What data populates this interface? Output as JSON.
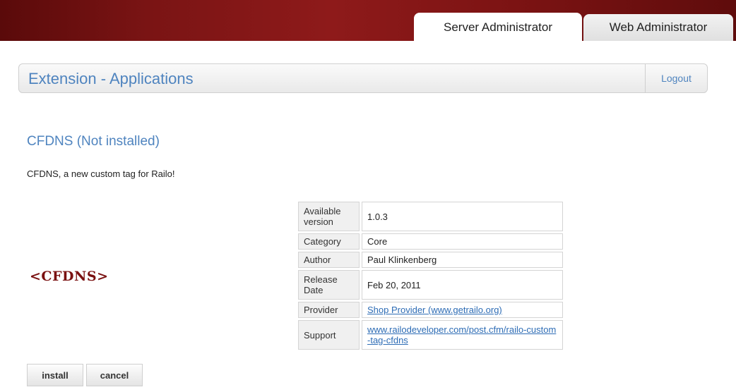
{
  "header": {
    "tabs": [
      {
        "label": "Server Administrator",
        "active": true
      },
      {
        "label": "Web Administrator",
        "active": false
      }
    ]
  },
  "page_bar": {
    "title": "Extension - Applications",
    "logout_label": "Logout"
  },
  "extension": {
    "title": "CFDNS (Not installed)",
    "description": "CFDNS, a new custom tag for Railo!",
    "logo_text": "<CFDNS>",
    "details": [
      {
        "label": "Available version",
        "value": "1.0.3"
      },
      {
        "label": "Category",
        "value": "Core"
      },
      {
        "label": "Author",
        "value": "Paul Klinkenberg"
      },
      {
        "label": "Release Date",
        "value": "Feb 20, 2011"
      },
      {
        "label": "Provider",
        "value": "Shop Provider (www.getrailo.org)"
      },
      {
        "label": "Support",
        "value": "www.railodeveloper.com/post.cfm/railo-custom-tag-cfdns"
      }
    ]
  },
  "buttons": {
    "install": "install",
    "cancel": "cancel"
  },
  "colors": {
    "header_red": "#7a1414",
    "link_blue": "#4f84bf",
    "logo_red": "#7a1010"
  }
}
